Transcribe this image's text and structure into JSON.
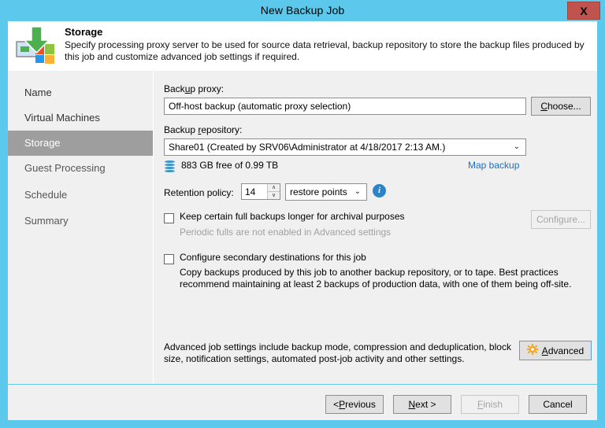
{
  "window": {
    "title": "New Backup Job",
    "close_label": "X",
    "accent_color": "#5bc8ec",
    "close_color": "#c0534d"
  },
  "header": {
    "icon": "backup-storage-icon",
    "title": "Storage",
    "description": "Specify processing proxy server to be used for source data retrieval, backup repository to store the backup files produced by this job and customize advanced job settings if required."
  },
  "sidebar": {
    "items": [
      {
        "label": "Name",
        "selected": false
      },
      {
        "label": "Virtual Machines",
        "selected": false
      },
      {
        "label": "Storage",
        "selected": true
      },
      {
        "label": "Guest Processing",
        "selected": false
      },
      {
        "label": "Schedule",
        "selected": false
      },
      {
        "label": "Summary",
        "selected": false
      }
    ]
  },
  "content": {
    "backup_proxy": {
      "label_pre": "Back",
      "label_accel": "u",
      "label_post": "p proxy:",
      "value": "Off-host backup (automatic proxy selection)",
      "choose_pre": "",
      "choose_accel": "C",
      "choose_post": "hoose..."
    },
    "backup_repository": {
      "label_pre": "Backup ",
      "label_accel": "r",
      "label_post": "epository:",
      "value": "Share01 (Created by SRV06\\Administrator at 4/18/2017 2:13 AM.)",
      "caret": "⌄",
      "capacity_text": "883 GB free of 0.99 TB",
      "capacity_icon": "disk-stack-icon",
      "map_backup_link": "Map backup"
    },
    "retention": {
      "label": "Retention policy:",
      "value": "14",
      "spin_up": "∧",
      "spin_down": "∨",
      "unit": "restore points",
      "unit_caret": "⌄",
      "info_icon_glyph": "i"
    },
    "archival": {
      "checked": false,
      "label": "Keep certain full backups longer for archival purposes",
      "note": "Periodic fulls are not enabled in Advanced settings",
      "configure_label": "Configure...",
      "configure_enabled": false
    },
    "secondary": {
      "checked": false,
      "label": "Configure secondary destinations for this job",
      "description": "Copy backups produced by this job to another backup repository, or to tape. Best practices recommend maintaining at least 2 backups of production data, with one of them being off-site."
    },
    "advanced": {
      "description": "Advanced job settings include backup mode, compression and deduplication, block size, notification settings, automated post-job activity and other settings.",
      "button_pre": "",
      "button_accel": "A",
      "button_post": "dvanced",
      "icon": "gear-icon"
    }
  },
  "footer": {
    "previous": {
      "pre": "< ",
      "accel": "P",
      "post": "revious",
      "enabled": true
    },
    "next": {
      "pre": "",
      "accel": "N",
      "post": "ext >",
      "enabled": true
    },
    "finish": {
      "pre": "",
      "accel": "F",
      "post": "inish",
      "enabled": false
    },
    "cancel": {
      "pre": "Cancel",
      "accel": "",
      "post": "",
      "enabled": true
    }
  }
}
